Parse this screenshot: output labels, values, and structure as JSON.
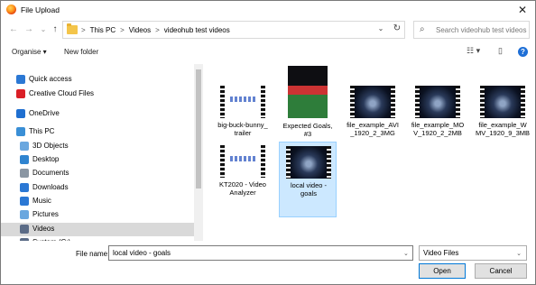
{
  "window": {
    "title": "File Upload",
    "close_glyph": "✕"
  },
  "nav": {
    "back_glyph": "←",
    "forward_glyph": "→",
    "recent_glyph": "⌄",
    "up_glyph": "↑"
  },
  "address": {
    "crumbs": [
      "This PC",
      "Videos",
      "videohub test videos"
    ],
    "separator": ">",
    "start_separator": ">",
    "dropdown_glyph": "⌄",
    "refresh_glyph": "↻"
  },
  "search": {
    "placeholder": "Search videohub test videos",
    "icon_glyph": "⌕"
  },
  "toolbar": {
    "organise": "Organise ▾",
    "new_folder": "New folder",
    "view_glyph": "☷ ▾",
    "pane_glyph": "▯",
    "help_glyph": "?"
  },
  "sidebar": {
    "items": [
      {
        "label": "Quick access",
        "icon": "star-icon",
        "color": "#2b78d4",
        "indent": 1,
        "selected": false
      },
      {
        "label": "Creative Cloud Files",
        "icon": "creative-cloud-icon",
        "color": "#da1f26",
        "indent": 1,
        "selected": false
      },
      {
        "label": "OneDrive",
        "icon": "cloud-icon",
        "color": "#1f6fd0",
        "indent": 1,
        "selected": false
      },
      {
        "label": "This PC",
        "icon": "computer-icon",
        "color": "#3a8fd6",
        "indent": 1,
        "selected": false
      },
      {
        "label": "3D Objects",
        "icon": "cube-icon",
        "color": "#6aa7df",
        "indent": 2,
        "selected": false
      },
      {
        "label": "Desktop",
        "icon": "desktop-icon",
        "color": "#2f84d0",
        "indent": 2,
        "selected": false
      },
      {
        "label": "Documents",
        "icon": "documents-icon",
        "color": "#8a96a3",
        "indent": 2,
        "selected": false
      },
      {
        "label": "Downloads",
        "icon": "download-icon",
        "color": "#2b78d4",
        "indent": 2,
        "selected": false
      },
      {
        "label": "Music",
        "icon": "music-icon",
        "color": "#2b78d4",
        "indent": 2,
        "selected": false
      },
      {
        "label": "Pictures",
        "icon": "pictures-icon",
        "color": "#6aa7df",
        "indent": 2,
        "selected": false
      },
      {
        "label": "Videos",
        "icon": "videos-icon",
        "color": "#5b6b86",
        "indent": 2,
        "selected": true
      },
      {
        "label": "System (C:)",
        "icon": "drive-icon",
        "color": "#5b6b86",
        "indent": 2,
        "selected": false
      }
    ]
  },
  "files": [
    {
      "label": "big-buck-bunny_\ntrailer",
      "thumb": "whiteslide",
      "selected": false
    },
    {
      "label": "Expected Goals,\n#3",
      "thumb": "poster",
      "selected": false
    },
    {
      "label": "file_example_AVI\n_1920_2_3MG",
      "thumb": "earth",
      "selected": false
    },
    {
      "label": "file_example_MO\nV_1920_2_2MB",
      "thumb": "earth",
      "selected": false
    },
    {
      "label": "file_example_W\nMV_1920_9_3MB",
      "thumb": "earth",
      "selected": false
    },
    {
      "label": "KT2020 - Video\nAnalyzer",
      "thumb": "whiteslide",
      "selected": false
    },
    {
      "label": "local video -\ngoals",
      "thumb": "earth",
      "selected": true
    }
  ],
  "footer": {
    "file_name_label": "File name:",
    "file_name_value": "local video - goals",
    "file_type_value": "Video Files",
    "caret_glyph": "⌄",
    "open_label": "Open",
    "cancel_label": "Cancel"
  }
}
